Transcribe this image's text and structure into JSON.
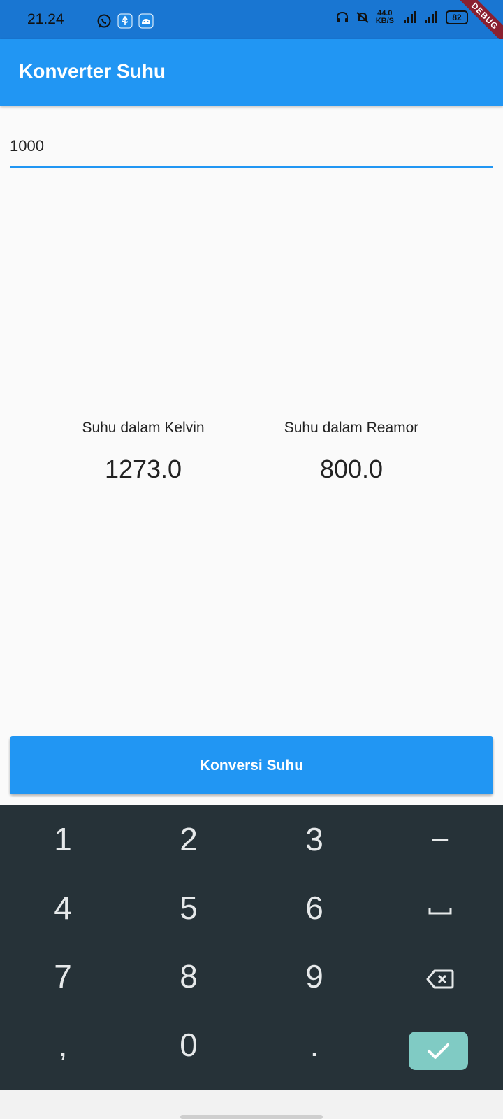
{
  "status_bar": {
    "time": "21.24",
    "net_speed_value": "44.0",
    "net_speed_unit": "KB/S",
    "battery": "82",
    "debug_label": "DEBUG"
  },
  "app_bar": {
    "title": "Konverter Suhu"
  },
  "input": {
    "value": "1000"
  },
  "results": {
    "kelvin_label": "Suhu dalam Kelvin",
    "kelvin_value": "1273.0",
    "reamur_label": "Suhu dalam Reamor",
    "reamur_value": "800.0"
  },
  "button": {
    "label": "Konversi Suhu"
  },
  "keyboard": {
    "keys": [
      "1",
      "2",
      "3",
      "−",
      "4",
      "5",
      "6",
      "␣",
      "7",
      "8",
      "9",
      "⌫",
      ",",
      "0",
      ".",
      "✓"
    ]
  },
  "colors": {
    "status_bar": "#1976d2",
    "app_bar": "#2196f3",
    "keyboard": "#263238",
    "enter_key": "#80cbc4"
  }
}
